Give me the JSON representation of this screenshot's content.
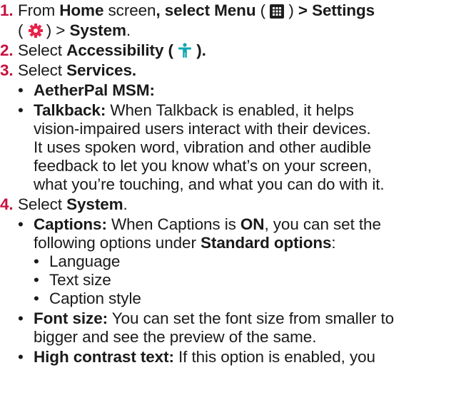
{
  "steps": [
    {
      "number": "1.",
      "l1": {
        "t1": "From ",
        "b1": "Home",
        "t2": " screen",
        "t3": ", select ",
        "b2": "Menu",
        "t4": " ( ",
        "t5": " ) ",
        "b3": "> Settings"
      },
      "l2": {
        "t1": "( ",
        "t2": " ) > ",
        "b1": "System",
        "t3": "."
      }
    },
    {
      "number": "2.",
      "t1": "Select ",
      "b1": "Accessibility",
      "t2": " ( ",
      "t3": " )."
    },
    {
      "number": "3.",
      "t1": "Select ",
      "b1": "Services."
    },
    {
      "number": "4.",
      "t1": "Select ",
      "b1": "System",
      "t2": "."
    }
  ],
  "services": {
    "aetherpal": "AetherPal MSM:",
    "talkback_label": "Talkback:",
    "talkback_lines": [
      " When Talkback is enabled,  it helps",
      "vision-impaired users interact with their devices.",
      "It uses spoken word, vibration and other audible",
      "feedback to let you know what’s on your screen,",
      "what you’re touching, and what you can do with it."
    ]
  },
  "system": {
    "captions_label": "Captions:",
    "captions_t1": " When Captions is ",
    "captions_on": "ON",
    "captions_t2": ", you can set the",
    "captions_t3": "following options under ",
    "captions_std": "Standard options",
    "captions_t4": ":",
    "caption_options": [
      "Language",
      "Text size",
      "Caption style"
    ],
    "font_size_label": "Font size:",
    "font_size_t1": " You can set the font size from smaller to",
    "font_size_t2": "bigger and see the preview of the same.",
    "high_contrast_label": "High contrast text:",
    "high_contrast_t1": " If this option is enabled, you"
  },
  "bullet": "•",
  "colors": {
    "step_number": "#c8103e",
    "settings_icon": "#e8234a",
    "accessibility_icon": "#12a6b4",
    "menu_icon": "#1f1f1f"
  },
  "icons": {
    "menu": "grid-menu-icon",
    "settings": "gear-icon",
    "accessibility": "accessibility-person-icon"
  }
}
